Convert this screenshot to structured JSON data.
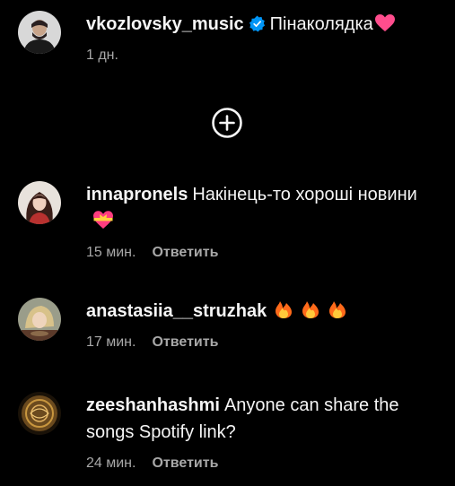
{
  "caption": {
    "username": "vkozlovsky_music",
    "text": "Пінаколядка",
    "time": "1 дн.",
    "verified_color": "#0095f6",
    "emoji": "pink-heart"
  },
  "load_more": {
    "icon": "circle-plus-icon"
  },
  "comments": [
    {
      "username": "innapronels",
      "text": "Накінець-то хороші новини",
      "emoji": "heart-with-ribbon",
      "time": "15 мин.",
      "reply": "Ответить"
    },
    {
      "username": "anastasiia__struzhak",
      "text": "",
      "emoji": "fire x3",
      "time": "17 мин.",
      "reply": "Ответить"
    },
    {
      "username": "zeeshanhashmi",
      "text": "Anyone can share the songs Spotify link?",
      "time": "24 мин.",
      "reply": "Ответить"
    }
  ],
  "colors": {
    "background": "#000000",
    "text": "#f5f5f5",
    "secondary": "#a8a8a8",
    "heart": "#ff4d8d",
    "fire": "#ff6a1a"
  }
}
